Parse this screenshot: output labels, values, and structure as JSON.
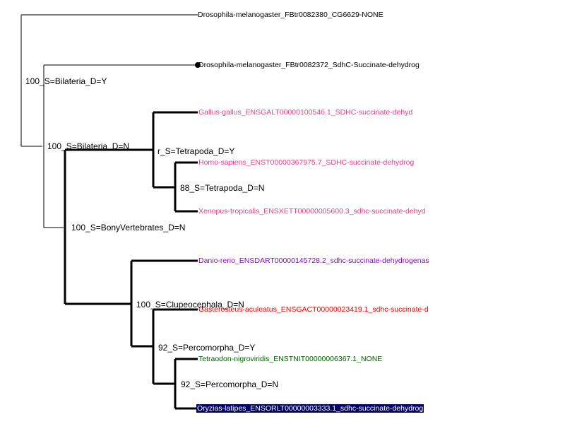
{
  "colors": {
    "outgroup": "#000000",
    "tetrapoda": "#e0408a",
    "danio": "#9400d3",
    "gasterosteus": "#ee0000",
    "tetraodon": "#006400",
    "highlight_bg": "#000066",
    "highlight_text": "#ffffff"
  },
  "leaves": [
    {
      "text": "Drosophila-melanogaster_FBtr0082380_CG6629-NONE",
      "color": "#000000"
    },
    {
      "text": "Drosophila-melanogaster_FBtr0082372_SdhC-Succinate-dehydrog",
      "color": "#000000"
    },
    {
      "text": "Gallus-gallus_ENSGALT00000100546.1_SDHC-succinate-dehyd",
      "color": "#e0408a"
    },
    {
      "text": "Homo-sapiens_ENST00000367975.7_SDHC-succinate-dehydrog",
      "color": "#e0408a"
    },
    {
      "text": "Xenopus-tropicalis_ENSXETT00000005600.3_sdhc-succinate-dehyd",
      "color": "#e0408a"
    },
    {
      "text": "Danio-rerio_ENSDART00000145728.2_sdhc-succinate-dehydrogenas",
      "color": "#9400d3"
    },
    {
      "text": "Gasterosteus-aculeatus_ENSGACT00000023419.1_sdhc-succinate-d",
      "color": "#ee0000"
    },
    {
      "text": "Tetraodon-nigroviridis_ENSTNIT00000006367.1_NONE",
      "color": "#006400"
    },
    {
      "text": "Oryzias-latipes_ENSORLT00000003333.1_sdhc-succinate-dehydrog",
      "color": "#ffffff"
    }
  ],
  "internal_nodes": {
    "bilateria_y": "100_S=Bilateria_D=Y",
    "bilateria_n": "100_S=Bilateria_D=N",
    "tetrapoda_1": "r_S=Tetrapoda_D=Y",
    "tetrapoda_2": "88_S=Tetrapoda_D=N",
    "bony_vertebrates": "100_S=BonyVertebrates_D=N",
    "clupeocephala": "100_S=Clupeocephala_D=N",
    "percomorpha_1": "92_S=Percomorpha_D=Y",
    "percomorpha_2": "92_S=Percomorpha_D=N"
  }
}
